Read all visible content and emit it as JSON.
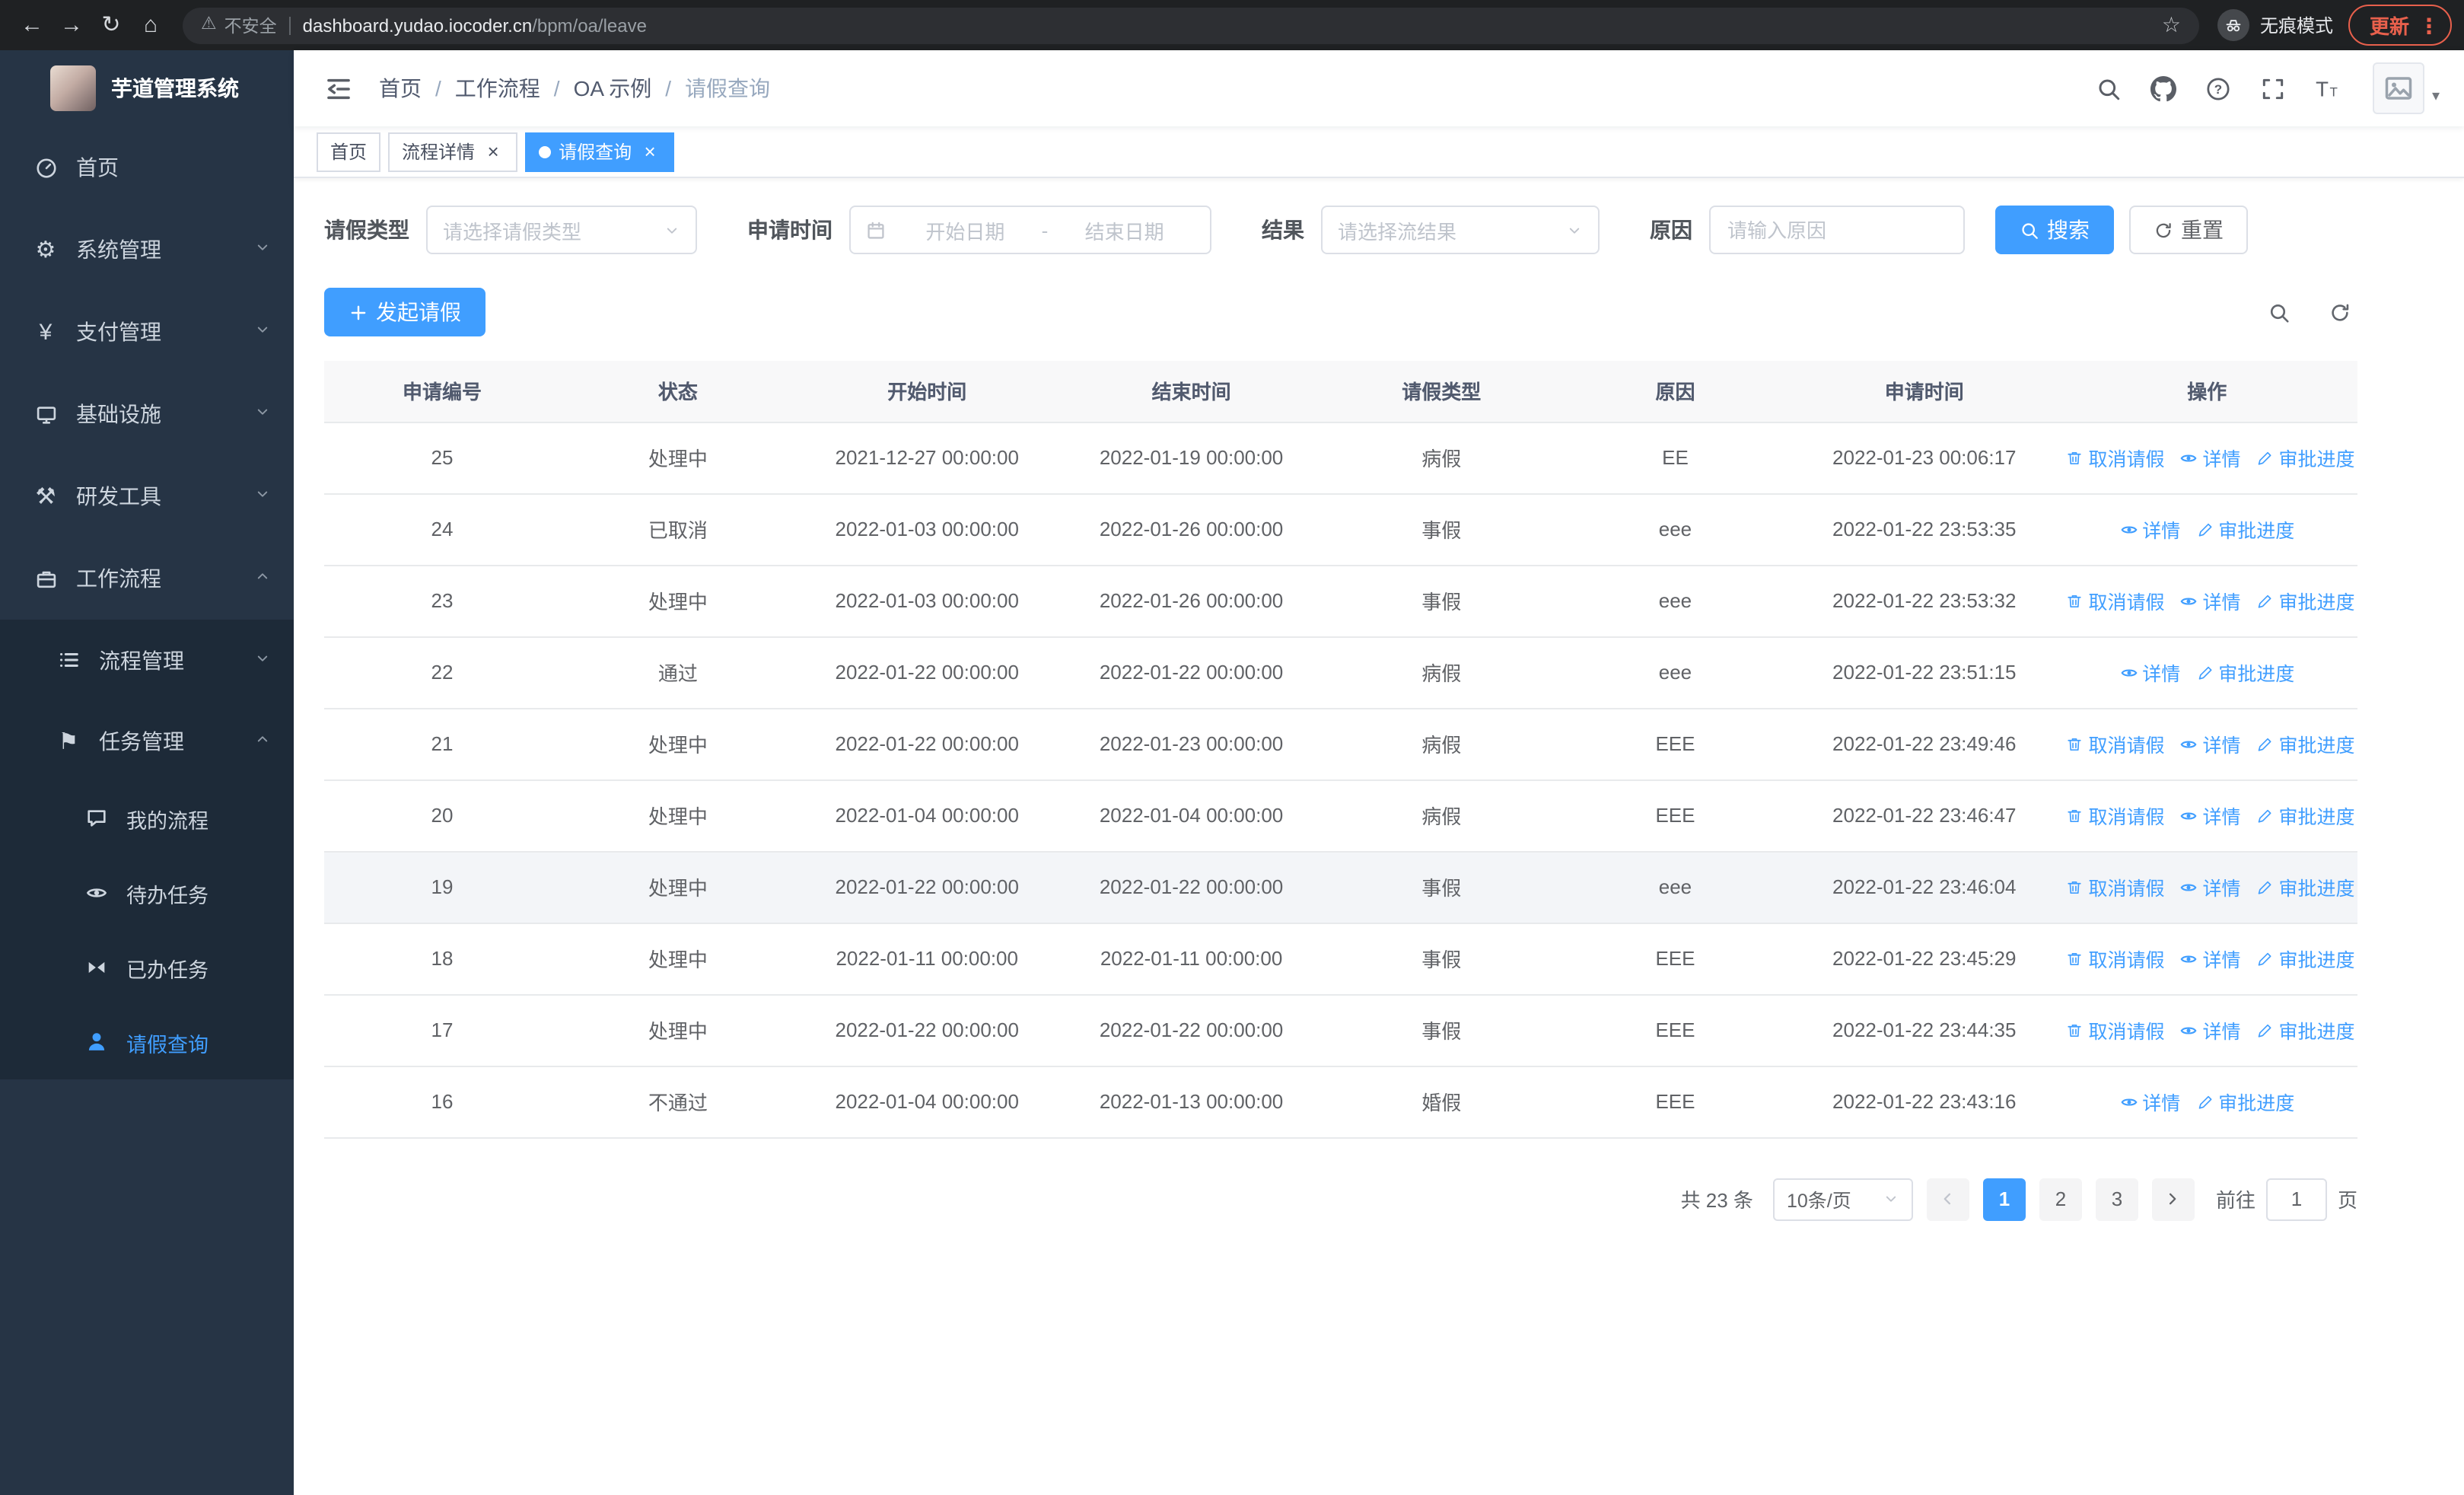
{
  "browser": {
    "nav_icons": [
      "back-icon",
      "forward-icon",
      "reload-icon",
      "home-icon"
    ],
    "security_warning": "不安全",
    "url_host": "dashboard.yudao.iocoder.cn",
    "url_path": "/bpm/oa/leave",
    "incognito_label": "无痕模式",
    "update_label": "更新"
  },
  "sidebar": {
    "logo_title": "芋道管理系统",
    "menu": [
      {
        "name": "home",
        "label": "首页",
        "icon": "dashboard-icon",
        "level": 1
      },
      {
        "name": "system-mgmt",
        "label": "系统管理",
        "icon": "gear-icon",
        "level": 1,
        "arrow": "down"
      },
      {
        "name": "payment-mgmt",
        "label": "支付管理",
        "icon": "payment-icon",
        "level": 1,
        "arrow": "down"
      },
      {
        "name": "infrastructure",
        "label": "基础设施",
        "icon": "infrastructure-icon",
        "level": 1,
        "arrow": "down"
      },
      {
        "name": "devtools",
        "label": "研发工具",
        "icon": "devtools-icon",
        "level": 1,
        "arrow": "down"
      },
      {
        "name": "workflow",
        "label": "工作流程",
        "icon": "workflow-icon",
        "level": 1,
        "arrow": "up"
      },
      {
        "name": "process-mgmt",
        "label": "流程管理",
        "icon": "process-list-icon",
        "level": 2,
        "arrow": "down"
      },
      {
        "name": "task-mgmt",
        "label": "任务管理",
        "icon": "task-flag-icon",
        "level": 2,
        "arrow": "up"
      },
      {
        "name": "my-process",
        "label": "我的流程",
        "icon": "chat-bubble-icon",
        "level": 3
      },
      {
        "name": "todo-tasks",
        "label": "待办任务",
        "icon": "eye-icon",
        "level": 3
      },
      {
        "name": "done-tasks",
        "label": "已办任务",
        "icon": "bowtie-icon",
        "level": 3
      },
      {
        "name": "leave-query",
        "label": "请假查询",
        "icon": "person-icon",
        "level": 3,
        "active": true
      }
    ]
  },
  "navbar": {
    "breadcrumb": [
      "首页",
      "工作流程",
      "OA 示例",
      "请假查询"
    ],
    "right_icons": [
      "search-icon",
      "github-icon",
      "help-icon",
      "fullscreen-icon",
      "font-size-icon"
    ]
  },
  "tabs": [
    {
      "name": "home",
      "label": "首页",
      "closable": false,
      "active": false
    },
    {
      "name": "process-detail",
      "label": "流程详情",
      "closable": true,
      "active": false
    },
    {
      "name": "leave-query",
      "label": "请假查询",
      "closable": true,
      "active": true
    }
  ],
  "filters": {
    "leave_type": {
      "label": "请假类型",
      "placeholder": "请选择请假类型",
      "icon": "chevron-down-icon"
    },
    "apply_time": {
      "label": "申请时间",
      "icon": "calendar-icon",
      "start_placeholder": "开始日期",
      "separator": "-",
      "end_placeholder": "结束日期"
    },
    "result": {
      "label": "结果",
      "placeholder": "请选择流结果",
      "icon": "chevron-down-icon"
    },
    "reason": {
      "label": "原因",
      "placeholder": "请输入原因"
    },
    "search_label": "搜索",
    "search_icon": "search-icon",
    "reset_label": "重置",
    "reset_icon": "refresh-icon"
  },
  "toolbar": {
    "create_label": "发起请假",
    "create_icon": "plus-icon",
    "right_icons": [
      "search-icon",
      "refresh-icon"
    ]
  },
  "table": {
    "columns": [
      "申请编号",
      "状态",
      "开始时间",
      "结束时间",
      "请假类型",
      "原因",
      "申请时间",
      "操作"
    ],
    "action_labels": {
      "cancel": "取消请假",
      "detail": "详情",
      "progress": "审批进度"
    },
    "action_icons": {
      "cancel": "trash-icon",
      "detail": "eye-icon",
      "progress": "edit-icon"
    },
    "rows": [
      {
        "id": "25",
        "status": "处理中",
        "start": "2021-12-27 00:00:00",
        "end": "2022-01-19 00:00:00",
        "type": "病假",
        "reason": "EE",
        "applied": "2022-01-23 00:06:17",
        "actions": [
          "cancel",
          "detail",
          "progress"
        ]
      },
      {
        "id": "24",
        "status": "已取消",
        "start": "2022-01-03 00:00:00",
        "end": "2022-01-26 00:00:00",
        "type": "事假",
        "reason": "eee",
        "applied": "2022-01-22 23:53:35",
        "actions": [
          "detail",
          "progress"
        ]
      },
      {
        "id": "23",
        "status": "处理中",
        "start": "2022-01-03 00:00:00",
        "end": "2022-01-26 00:00:00",
        "type": "事假",
        "reason": "eee",
        "applied": "2022-01-22 23:53:32",
        "actions": [
          "cancel",
          "detail",
          "progress"
        ]
      },
      {
        "id": "22",
        "status": "通过",
        "start": "2022-01-22 00:00:00",
        "end": "2022-01-22 00:00:00",
        "type": "病假",
        "reason": "eee",
        "applied": "2022-01-22 23:51:15",
        "actions": [
          "detail",
          "progress"
        ]
      },
      {
        "id": "21",
        "status": "处理中",
        "start": "2022-01-22 00:00:00",
        "end": "2022-01-23 00:00:00",
        "type": "病假",
        "reason": "EEE",
        "applied": "2022-01-22 23:49:46",
        "actions": [
          "cancel",
          "detail",
          "progress"
        ]
      },
      {
        "id": "20",
        "status": "处理中",
        "start": "2022-01-04 00:00:00",
        "end": "2022-01-04 00:00:00",
        "type": "病假",
        "reason": "EEE",
        "applied": "2022-01-22 23:46:47",
        "actions": [
          "cancel",
          "detail",
          "progress"
        ]
      },
      {
        "id": "19",
        "status": "处理中",
        "start": "2022-01-22 00:00:00",
        "end": "2022-01-22 00:00:00",
        "type": "事假",
        "reason": "eee",
        "applied": "2022-01-22 23:46:04",
        "actions": [
          "cancel",
          "detail",
          "progress"
        ],
        "highlighted": true
      },
      {
        "id": "18",
        "status": "处理中",
        "start": "2022-01-11 00:00:00",
        "end": "2022-01-11 00:00:00",
        "type": "事假",
        "reason": "EEE",
        "applied": "2022-01-22 23:45:29",
        "actions": [
          "cancel",
          "detail",
          "progress"
        ]
      },
      {
        "id": "17",
        "status": "处理中",
        "start": "2022-01-22 00:00:00",
        "end": "2022-01-22 00:00:00",
        "type": "事假",
        "reason": "EEE",
        "applied": "2022-01-22 23:44:35",
        "actions": [
          "cancel",
          "detail",
          "progress"
        ]
      },
      {
        "id": "16",
        "status": "不通过",
        "start": "2022-01-04 00:00:00",
        "end": "2022-01-13 00:00:00",
        "type": "婚假",
        "reason": "EEE",
        "applied": "2022-01-22 23:43:16",
        "actions": [
          "detail",
          "progress"
        ]
      }
    ]
  },
  "pagination": {
    "total_label": "共 23 条",
    "page_size": "10条/页",
    "pages": [
      "1",
      "2",
      "3"
    ],
    "active_page": "1",
    "goto_prefix": "前往",
    "goto_value": "1",
    "goto_suffix": "页"
  },
  "colors": {
    "primary": "#409eff",
    "sidebar_bg": "#263445",
    "submenu_bg": "#1d2a38",
    "chrome_bg": "#1f2123",
    "update_red": "#e8604c",
    "table_header_bg": "#f8f8f9"
  }
}
